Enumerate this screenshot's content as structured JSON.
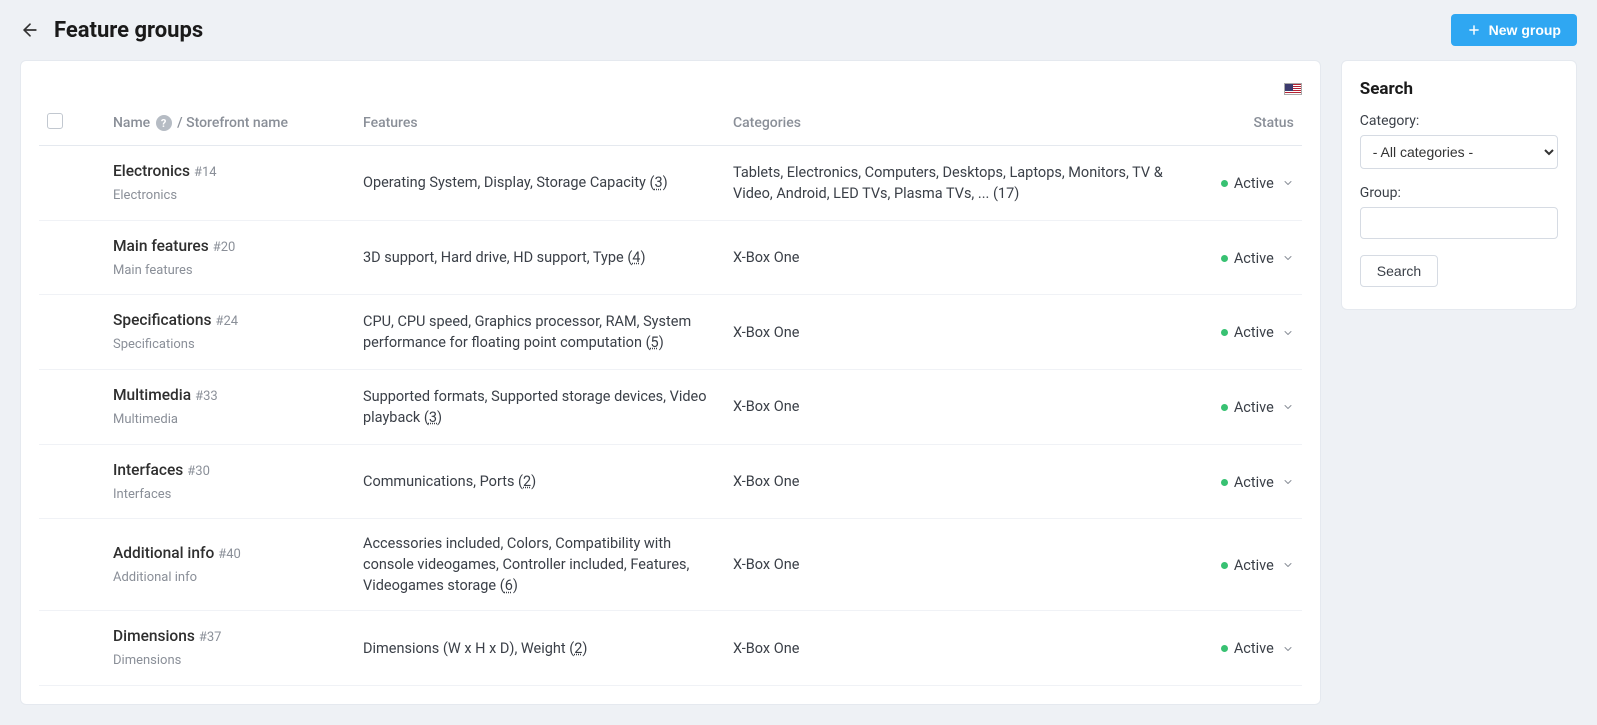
{
  "header": {
    "title": "Feature groups",
    "new_group_label": "New group"
  },
  "table": {
    "columns": {
      "name_prefix": "Name",
      "name_suffix": " / Storefront name",
      "features": "Features",
      "categories": "Categories",
      "status": "Status"
    },
    "rows": [
      {
        "name": "Electronics",
        "id": "#14",
        "storefront": "Electronics",
        "features_text": "Operating System, Display, Storage Capacity ",
        "features_count": "3",
        "categories": "Tablets, Electronics, Computers, Desktops, Laptops, Monitors, TV & Video, Android, LED TVs, Plasma TVs, ... (17)",
        "status": "Active"
      },
      {
        "name": "Main features",
        "id": "#20",
        "storefront": "Main features",
        "features_text": "3D support, Hard drive, HD support, Type ",
        "features_count": "4",
        "categories": "X-Box One",
        "status": "Active"
      },
      {
        "name": "Specifications",
        "id": "#24",
        "storefront": "Specifications",
        "features_text": "CPU, CPU speed, Graphics processor, RAM, System performance for floating point computation ",
        "features_count": "5",
        "categories": "X-Box One",
        "status": "Active"
      },
      {
        "name": "Multimedia",
        "id": "#33",
        "storefront": "Multimedia",
        "features_text": "Supported formats, Supported storage devices, Video playback ",
        "features_count": "3",
        "categories": "X-Box One",
        "status": "Active"
      },
      {
        "name": "Interfaces",
        "id": "#30",
        "storefront": "Interfaces",
        "features_text": "Communications, Ports ",
        "features_count": "2",
        "categories": "X-Box One",
        "status": "Active"
      },
      {
        "name": "Additional info",
        "id": "#40",
        "storefront": "Additional info",
        "features_text": "Accessories included, Colors, Compatibility with console videogames, Controller included, Features, Videogames storage ",
        "features_count": "6",
        "categories": "X-Box One",
        "status": "Active"
      },
      {
        "name": "Dimensions",
        "id": "#37",
        "storefront": "Dimensions",
        "features_text": "Dimensions (W x H x D), Weight ",
        "features_count": "2",
        "categories": "X-Box One",
        "status": "Active"
      }
    ]
  },
  "search": {
    "title": "Search",
    "category_label": "Category:",
    "category_value": "- All categories -",
    "group_label": "Group:",
    "group_value": "",
    "submit_label": "Search"
  }
}
